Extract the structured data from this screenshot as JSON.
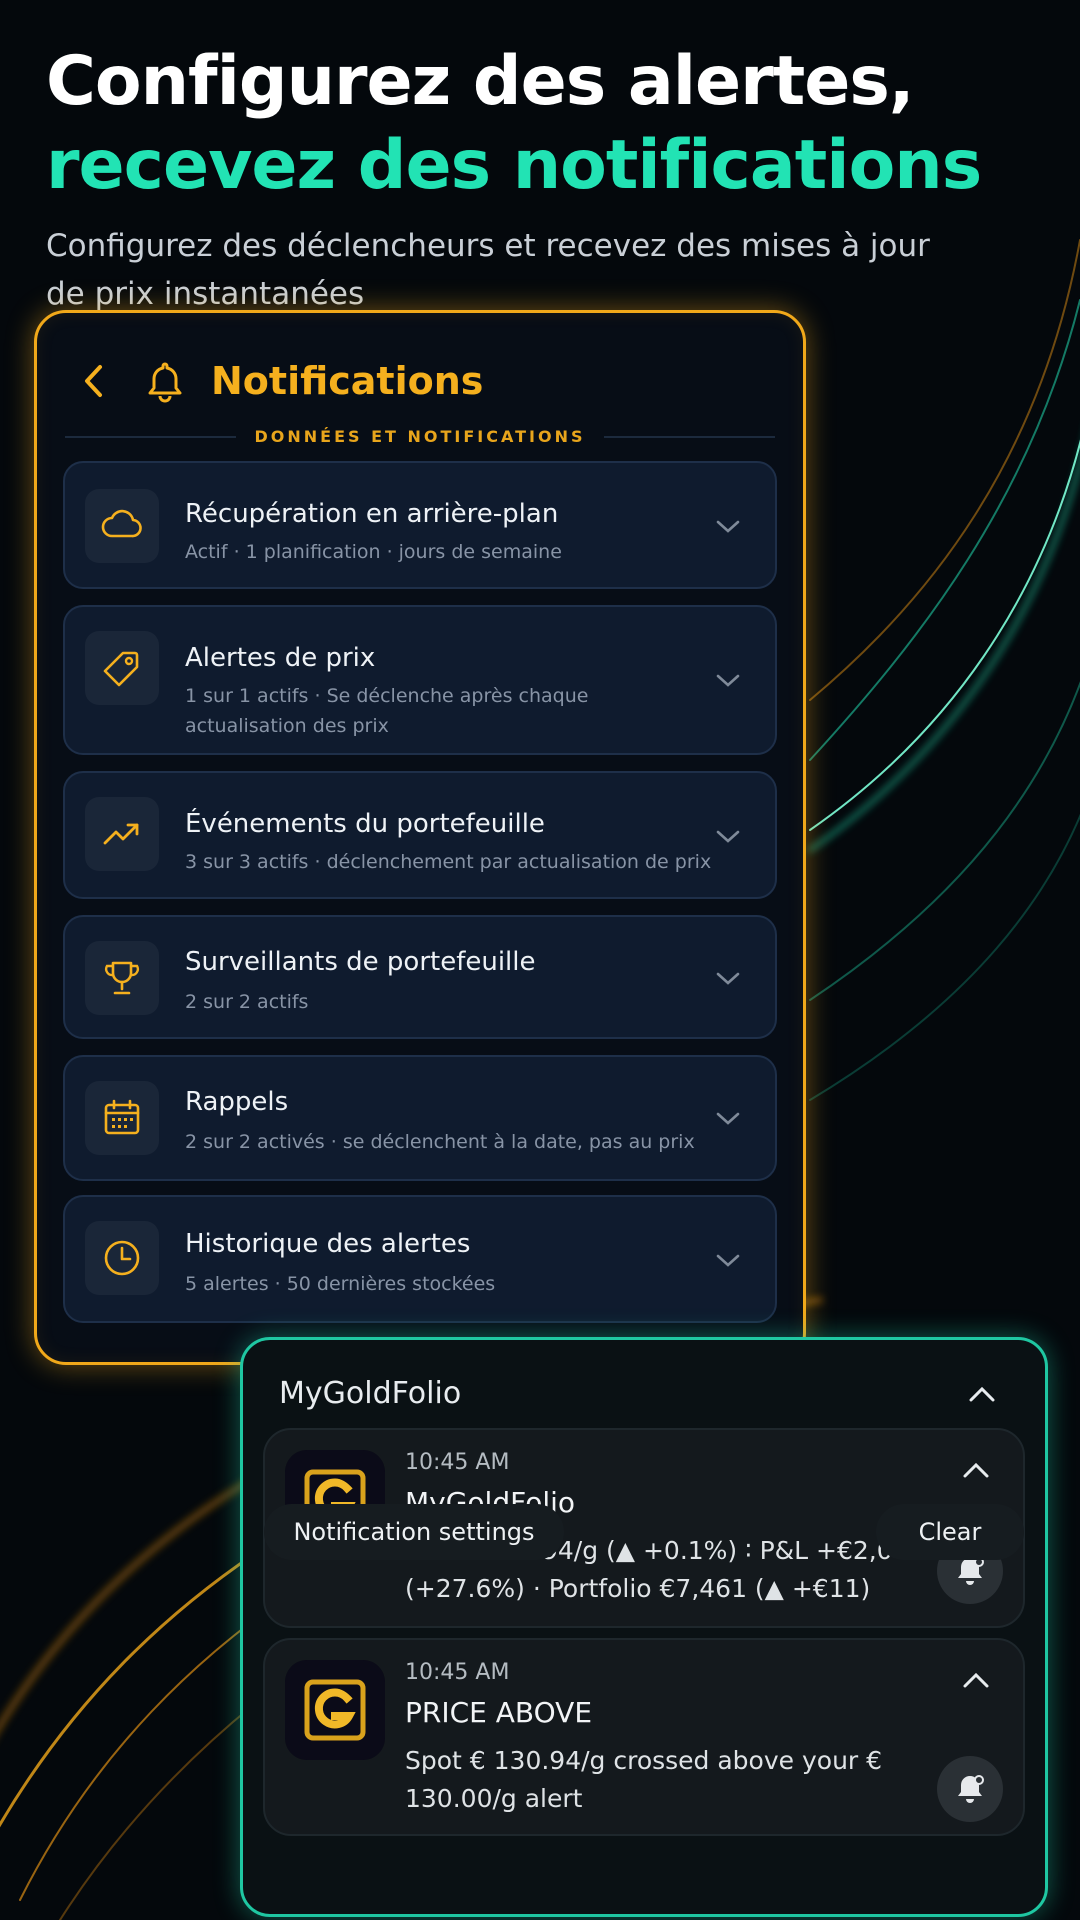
{
  "hero": {
    "line1": "Configurez des alertes,",
    "line2": "recevez des notifications",
    "subtitle": "Configurez des déclencheurs et recevez des mises à jour de prix instantanées"
  },
  "panel": {
    "title": "Notifications",
    "section_label": "DONNÉES ET NOTIFICATIONS",
    "items": [
      {
        "title": "Récupération en arrière-plan",
        "subtitle": "Actif · 1 planification · jours de semaine",
        "icon": "cloud-icon"
      },
      {
        "title": "Alertes de prix",
        "subtitle": "1 sur 1 actifs  ·  Se déclenche après chaque actualisation des prix",
        "icon": "tag-icon"
      },
      {
        "title": "Événements du portefeuille",
        "subtitle": "3 sur 3 actifs  ·  déclenchement par actualisation de prix",
        "icon": "trend-up-icon"
      },
      {
        "title": "Surveillants de portefeuille",
        "subtitle": "2 sur 2 actifs",
        "icon": "trophy-icon"
      },
      {
        "title": "Rappels",
        "subtitle": "2 sur 2 activés  ·  se déclenchent à la date, pas au prix",
        "icon": "calendar-icon"
      },
      {
        "title": "Historique des alertes",
        "subtitle": "5 alertes  ·  50 dernières stockées",
        "icon": "clock-icon"
      }
    ]
  },
  "notification_shade": {
    "app_name": "MyGoldFolio",
    "notifications": [
      {
        "time": "10:45 AM",
        "title": "MyGoldFolio",
        "body": "Gold €130.94/g (▲ +0.1%) ∶ P&L +€2,047 (+27.6%) · Portfolio €7,461 (▲ +€11)"
      },
      {
        "time": "10:45 AM",
        "title": "PRICE ABOVE",
        "body": "Spot € 130.94/g crossed above your € 130.00/g alert"
      }
    ],
    "settings_label": "Notification settings",
    "clear_label": "Clear"
  },
  "colors": {
    "gold": "#f5b01e",
    "teal": "#22e3b4",
    "background": "#04080c"
  }
}
